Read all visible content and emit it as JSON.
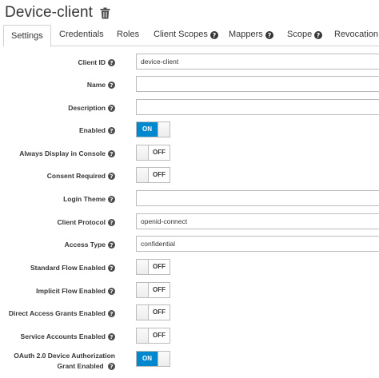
{
  "header": {
    "title": "Device-client"
  },
  "tabs": [
    {
      "label": "Settings",
      "active": true,
      "help": false
    },
    {
      "label": "Credentials",
      "active": false,
      "help": false
    },
    {
      "label": "Roles",
      "active": false,
      "help": false
    },
    {
      "label": "Client Scopes",
      "active": false,
      "help": true
    },
    {
      "label": "Mappers",
      "active": false,
      "help": true
    },
    {
      "label": "Scope",
      "active": false,
      "help": true
    },
    {
      "label": "Revocation",
      "active": false,
      "help": false
    }
  ],
  "form": {
    "client_id": {
      "label": "Client ID",
      "value": "device-client"
    },
    "name": {
      "label": "Name",
      "value": ""
    },
    "description": {
      "label": "Description",
      "value": ""
    },
    "enabled": {
      "label": "Enabled",
      "state": "ON"
    },
    "always_display": {
      "label": "Always Display in Console",
      "state": "OFF"
    },
    "consent_required": {
      "label": "Consent Required",
      "state": "OFF"
    },
    "login_theme": {
      "label": "Login Theme",
      "value": ""
    },
    "client_protocol": {
      "label": "Client Protocol",
      "value": "openid-connect"
    },
    "access_type": {
      "label": "Access Type",
      "value": "confidential"
    },
    "standard_flow": {
      "label": "Standard Flow Enabled",
      "state": "OFF"
    },
    "implicit_flow": {
      "label": "Implicit Flow Enabled",
      "state": "OFF"
    },
    "direct_access": {
      "label": "Direct Access Grants Enabled",
      "state": "OFF"
    },
    "service_accounts": {
      "label": "Service Accounts Enabled",
      "state": "OFF"
    },
    "device_grant": {
      "label_line1": "OAuth 2.0 Device Authorization",
      "label_line2": "Grant Enabled",
      "state": "ON"
    }
  },
  "colors": {
    "accent": "#0088ce",
    "border": "#bbbbbb",
    "text": "#363636"
  }
}
